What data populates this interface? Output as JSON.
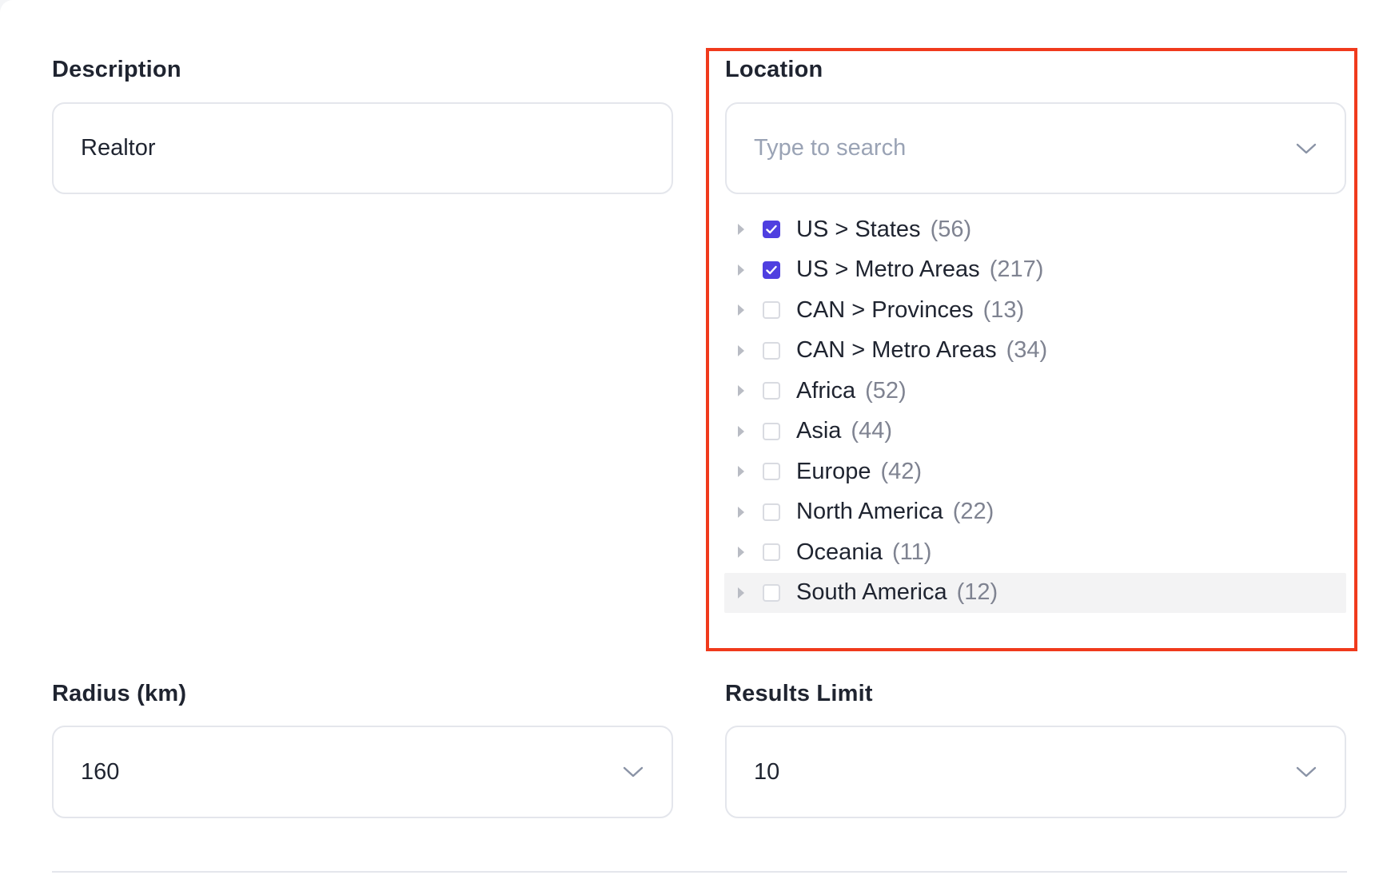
{
  "description": {
    "label": "Description",
    "value": "Realtor"
  },
  "location": {
    "label": "Location",
    "search_placeholder": "Type to search",
    "items": [
      {
        "label": "US > States",
        "count": "(56)",
        "checked": true
      },
      {
        "label": "US > Metro Areas",
        "count": "(217)",
        "checked": true
      },
      {
        "label": "CAN > Provinces",
        "count": "(13)",
        "checked": false
      },
      {
        "label": "CAN > Metro Areas",
        "count": "(34)",
        "checked": false
      },
      {
        "label": "Africa",
        "count": "(52)",
        "checked": false
      },
      {
        "label": "Asia",
        "count": "(44)",
        "checked": false
      },
      {
        "label": "Europe",
        "count": "(42)",
        "checked": false
      },
      {
        "label": "North America",
        "count": "(22)",
        "checked": false
      },
      {
        "label": "Oceania",
        "count": "(11)",
        "checked": false
      },
      {
        "label": "South America",
        "count": "(12)",
        "checked": false
      }
    ]
  },
  "radius": {
    "label": "Radius (km)",
    "value": "160"
  },
  "results_limit": {
    "label": "Results Limit",
    "value": "10"
  },
  "colors": {
    "accent": "#4f3fe0",
    "highlight": "#f03a1c",
    "border": "#e4e6ec",
    "placeholder": "#9aa3b5"
  },
  "icons": {
    "dropdown": "chevron-down-icon",
    "expand": "caret-right-icon",
    "checked": "checkmark-icon"
  }
}
